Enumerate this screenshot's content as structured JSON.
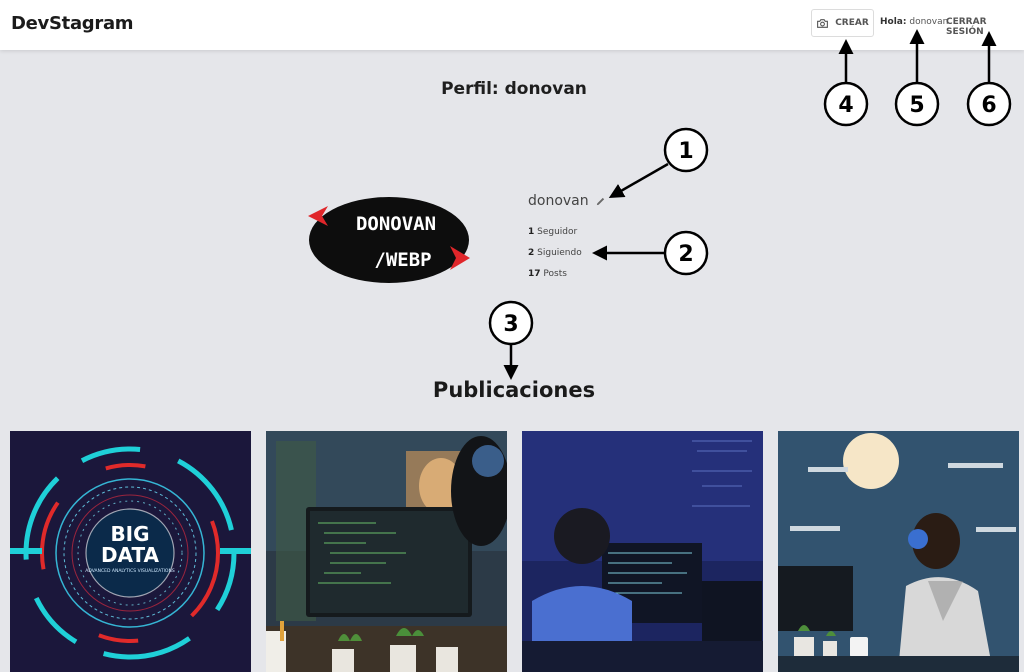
{
  "header": {
    "brand": "DevStagram",
    "crear_label": "CREAR",
    "greeting_prefix": "Hola:",
    "greeting_user": "donovan",
    "logout_label": "CERRAR SESIÓN"
  },
  "profile": {
    "title": "Perfil: donovan",
    "avatar_text_line1": "DONOVAN",
    "avatar_text_line2": "/WEBP",
    "username": "donovan",
    "followers_count": "1",
    "followers_label": "Seguidor",
    "following_count": "2",
    "following_label": "Siguiendo",
    "posts_count": "17",
    "posts_label": "Posts"
  },
  "publications": {
    "title": "Publicaciones",
    "posts": [
      {
        "big": "BIG",
        "data": "DATA",
        "caption": "ADVANCED ANALYTICS VISUALIZATIONS"
      },
      {},
      {},
      {}
    ]
  },
  "annotations": [
    "1",
    "2",
    "3",
    "4",
    "5",
    "6"
  ],
  "colors": {
    "background": "#e5e6ea",
    "header": "#ffffff",
    "avatar_red": "#e0262a",
    "annotation_stroke": "#000000"
  }
}
